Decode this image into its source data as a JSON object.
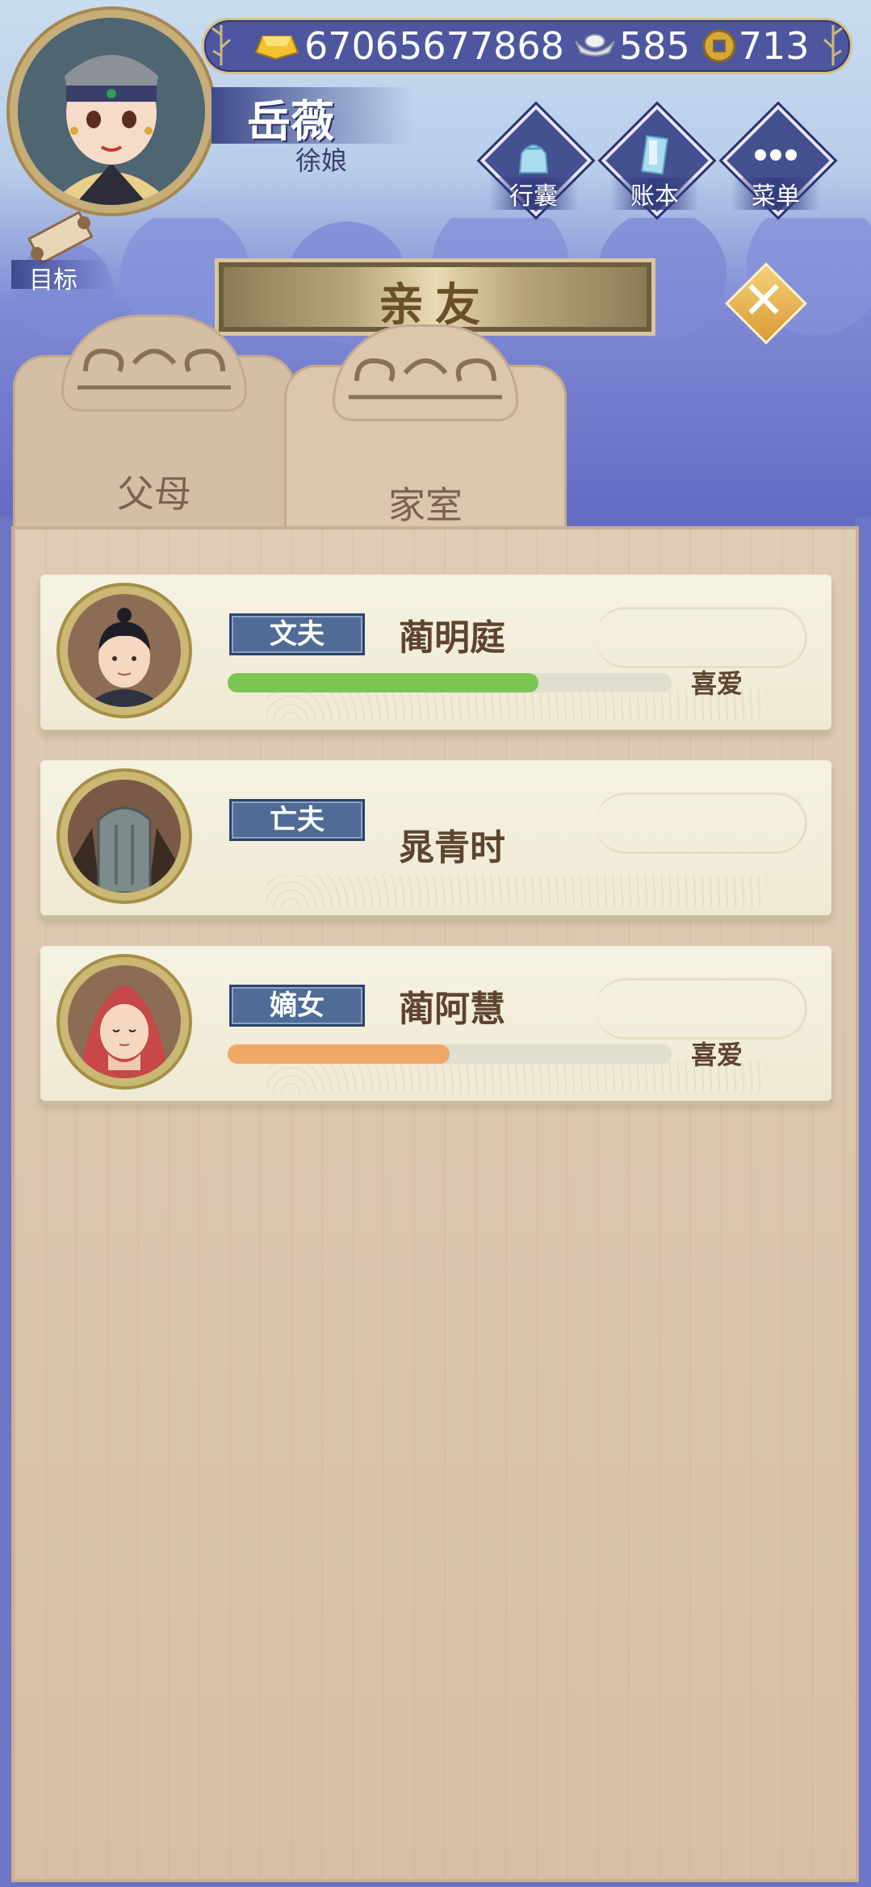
{
  "currency": {
    "gold": "67065677868",
    "silver": "585",
    "coins": "713"
  },
  "player": {
    "name": "岳薇",
    "title": "徐娘"
  },
  "top_menu": [
    {
      "label": "行囊",
      "icon": "bag-icon"
    },
    {
      "label": "账本",
      "icon": "ledger-icon"
    },
    {
      "label": "菜单",
      "icon": "menu-dots-icon"
    }
  ],
  "goal_label": "目标",
  "page_title": "亲友",
  "tabs": [
    {
      "label": "父母",
      "active": false
    },
    {
      "label": "家室",
      "active": true
    }
  ],
  "relatives": [
    {
      "relation": "文夫",
      "name": "蔺明庭",
      "affection_label": "喜爱",
      "affection": 0.7,
      "bar_color": "#7cc454"
    },
    {
      "relation": "亡夫",
      "name": "晁青时",
      "affection_label": "",
      "affection": null,
      "bar_color": ""
    },
    {
      "relation": "嫡女",
      "name": "蔺阿慧",
      "affection_label": "喜爱",
      "affection": 0.5,
      "bar_color": "#f0a866"
    }
  ]
}
